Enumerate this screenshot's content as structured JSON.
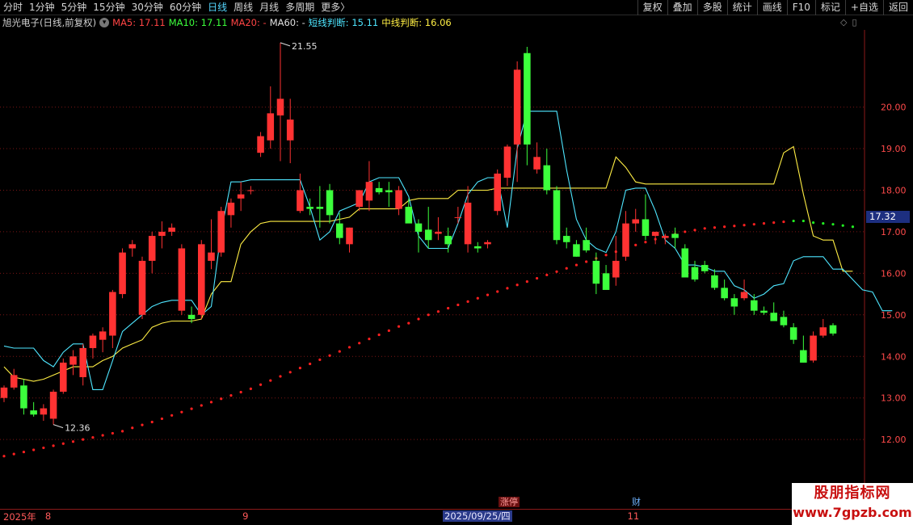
{
  "toolbar": {
    "tabs": [
      {
        "label": "分时"
      },
      {
        "label": "1分钟"
      },
      {
        "label": "5分钟"
      },
      {
        "label": "15分钟"
      },
      {
        "label": "30分钟"
      },
      {
        "label": "60分钟"
      },
      {
        "label": "日线"
      },
      {
        "label": "周线"
      },
      {
        "label": "月线"
      },
      {
        "label": "多周期"
      },
      {
        "label": "更多〉"
      }
    ],
    "active_tab": "日线",
    "right_buttons": [
      {
        "label": "复权"
      },
      {
        "label": "叠加"
      },
      {
        "label": "多股"
      },
      {
        "label": "统计"
      },
      {
        "label": "画线"
      },
      {
        "label": "F10"
      },
      {
        "label": "标记"
      },
      {
        "label": "+自选"
      },
      {
        "label": "返回"
      }
    ]
  },
  "info": {
    "stock": "旭光电子(日线,前复权)",
    "ma5": "MA5: 17.11",
    "ma10": "MA10: 17.11",
    "ma20": "MA20: -",
    "ma60": "MA60: -",
    "short_judge": "短线判断: 15.11",
    "mid_judge": "中线判断: 16.06"
  },
  "colors": {
    "up": "#ff3232",
    "down": "#3cff3c",
    "short_line": "#4ee6ff",
    "mid_line": "#ffee44",
    "red_dots": "#ff2020",
    "green_dots": "#22ee22",
    "grid": "#7a1515",
    "axis_text": "#ff4a4a"
  },
  "chart_data": {
    "type": "candlestick",
    "y_ticks": [
      "20.00",
      "19.00",
      "18.00",
      "17.00",
      "16.00",
      "15.00",
      "14.00",
      "13.00",
      "12.00"
    ],
    "y_tick_values": [
      20,
      19,
      18,
      17,
      16,
      15,
      14,
      13,
      12
    ],
    "ylim": [
      11.4,
      21.8
    ],
    "high_label": "21.55",
    "low_label": "12.36",
    "current_price_tag": "17.32",
    "candles_ohlc": [
      [
        13.0,
        13.3,
        12.9,
        13.25
      ],
      [
        13.25,
        13.7,
        13.2,
        13.55
      ],
      [
        13.3,
        13.45,
        12.6,
        12.75
      ],
      [
        12.7,
        12.9,
        12.55,
        12.6
      ],
      [
        12.6,
        12.85,
        12.45,
        12.75
      ],
      [
        12.5,
        13.2,
        12.36,
        13.15
      ],
      [
        13.15,
        13.95,
        13.1,
        13.85
      ],
      [
        13.8,
        14.15,
        13.55,
        14.0
      ],
      [
        13.5,
        14.3,
        13.3,
        14.2
      ],
      [
        14.2,
        14.55,
        13.95,
        14.5
      ],
      [
        14.4,
        14.7,
        14.1,
        14.6
      ],
      [
        14.5,
        15.6,
        14.2,
        15.55
      ],
      [
        15.5,
        16.6,
        15.4,
        16.5
      ],
      [
        16.6,
        16.8,
        16.4,
        16.7
      ],
      [
        15.0,
        16.4,
        14.9,
        16.3
      ],
      [
        16.3,
        17.0,
        16.0,
        16.9
      ],
      [
        16.9,
        17.25,
        16.6,
        17.0
      ],
      [
        17.0,
        17.2,
        16.9,
        17.1
      ],
      [
        15.1,
        16.7,
        15.0,
        16.6
      ],
      [
        15.0,
        15.2,
        14.8,
        14.9
      ],
      [
        15.0,
        16.8,
        14.9,
        16.7
      ],
      [
        16.3,
        17.3,
        16.1,
        16.5
      ],
      [
        16.5,
        17.6,
        16.4,
        17.5
      ],
      [
        17.4,
        17.8,
        17.1,
        17.7
      ],
      [
        17.8,
        18.2,
        17.5,
        17.9
      ],
      [
        18.0,
        18.1,
        17.9,
        18.0
      ],
      [
        18.9,
        19.4,
        18.8,
        19.3
      ],
      [
        19.2,
        20.5,
        19.0,
        19.85
      ],
      [
        19.8,
        21.55,
        18.7,
        20.2
      ],
      [
        19.2,
        20.2,
        18.65,
        19.7
      ],
      [
        17.5,
        18.4,
        17.45,
        18.0
      ],
      [
        17.6,
        17.8,
        17.4,
        17.55
      ],
      [
        17.6,
        18.1,
        17.1,
        17.55
      ],
      [
        18.0,
        18.15,
        17.2,
        17.4
      ],
      [
        17.2,
        17.45,
        16.7,
        16.85
      ],
      [
        16.7,
        17.1,
        16.5,
        17.1
      ],
      [
        17.6,
        18.0,
        17.5,
        18.0
      ],
      [
        17.75,
        18.7,
        17.5,
        18.2
      ],
      [
        18.05,
        18.2,
        17.9,
        17.95
      ],
      [
        18.0,
        18.2,
        17.6,
        17.95
      ],
      [
        17.55,
        18.1,
        17.4,
        18.0
      ],
      [
        17.6,
        17.8,
        17.4,
        17.2
      ],
      [
        17.2,
        17.3,
        16.5,
        17.0
      ],
      [
        17.05,
        17.6,
        16.6,
        16.8
      ],
      [
        16.95,
        17.35,
        16.8,
        17.0
      ],
      [
        16.9,
        17.1,
        16.5,
        16.7
      ],
      [
        17.35,
        17.6,
        17.2,
        17.35
      ],
      [
        16.7,
        18.1,
        16.5,
        17.7
      ],
      [
        16.65,
        16.75,
        16.5,
        16.6
      ],
      [
        16.7,
        16.8,
        16.6,
        16.75
      ],
      [
        17.5,
        18.5,
        17.4,
        18.4
      ],
      [
        18.3,
        19.1,
        18.1,
        19.05
      ],
      [
        19.1,
        21.1,
        18.2,
        20.9
      ],
      [
        21.3,
        21.45,
        18.6,
        19.1
      ],
      [
        18.5,
        19.15,
        18.4,
        18.8
      ],
      [
        18.6,
        19.0,
        17.9,
        18.0
      ],
      [
        18.0,
        18.1,
        16.7,
        16.8
      ],
      [
        16.9,
        17.1,
        16.6,
        16.75
      ],
      [
        16.7,
        16.8,
        16.4,
        16.4
      ],
      [
        16.8,
        17.1,
        16.5,
        16.55
      ],
      [
        16.3,
        16.5,
        15.5,
        15.75
      ],
      [
        16.0,
        16.2,
        15.8,
        15.6
      ],
      [
        15.9,
        16.9,
        15.7,
        16.3
      ],
      [
        16.4,
        17.5,
        16.3,
        17.2
      ],
      [
        17.2,
        17.55,
        17.0,
        17.3
      ],
      [
        17.3,
        17.9,
        16.8,
        16.9
      ],
      [
        16.9,
        17.0,
        16.7,
        17.0
      ],
      [
        16.85,
        16.95,
        16.7,
        16.9
      ],
      [
        16.95,
        17.1,
        16.6,
        16.85
      ],
      [
        16.6,
        16.7,
        16.0,
        15.9
      ],
      [
        16.15,
        16.3,
        15.8,
        15.85
      ],
      [
        16.2,
        16.3,
        16.0,
        16.05
      ],
      [
        15.95,
        16.1,
        15.6,
        15.65
      ],
      [
        15.65,
        15.85,
        15.35,
        15.4
      ],
      [
        15.4,
        15.5,
        15.0,
        15.2
      ],
      [
        15.4,
        15.85,
        15.35,
        15.55
      ],
      [
        15.35,
        15.5,
        15.0,
        15.1
      ],
      [
        15.1,
        15.2,
        15.0,
        15.05
      ],
      [
        15.05,
        15.3,
        14.9,
        14.85
      ],
      [
        14.95,
        15.1,
        14.7,
        14.75
      ],
      [
        14.7,
        14.8,
        14.3,
        14.4
      ],
      [
        14.15,
        14.5,
        13.85,
        13.85
      ],
      [
        13.9,
        14.6,
        13.85,
        14.5
      ],
      [
        14.5,
        14.9,
        14.45,
        14.7
      ],
      [
        14.75,
        14.8,
        14.5,
        14.55
      ]
    ],
    "short_judge_line": [
      14.25,
      14.2,
      14.2,
      14.2,
      13.9,
      13.75,
      14.1,
      14.3,
      14.3,
      13.2,
      13.2,
      13.9,
      14.6,
      14.8,
      15.0,
      15.2,
      15.3,
      15.35,
      15.35,
      15.35,
      15.0,
      15.2,
      17.0,
      18.2,
      18.2,
      18.25,
      18.25,
      18.25,
      18.25,
      18.25,
      18.25,
      17.6,
      16.8,
      17.0,
      17.5,
      17.6,
      17.7,
      18.2,
      18.3,
      18.3,
      18.3,
      17.85,
      16.9,
      16.6,
      16.6,
      16.6,
      17.2,
      17.9,
      18.2,
      18.3,
      18.3,
      17.1,
      19.0,
      19.9,
      19.9,
      19.9,
      19.9,
      18.5,
      17.3,
      16.8,
      16.6,
      16.5,
      17.0,
      18.0,
      18.05,
      18.05,
      17.5,
      16.8,
      16.6,
      16.2,
      16.2,
      16.15,
      16.05,
      16.05,
      15.7,
      15.6,
      15.4,
      15.5,
      15.7,
      15.75,
      16.3,
      16.4,
      16.4,
      16.4,
      16.1,
      16.1,
      15.85,
      15.6,
      15.55,
      15.1,
      15.1
    ],
    "mid_judge_line": [
      13.75,
      13.5,
      13.45,
      13.4,
      13.45,
      13.55,
      13.65,
      13.75,
      13.75,
      13.75,
      13.9,
      14.0,
      14.2,
      14.3,
      14.4,
      14.7,
      14.8,
      14.85,
      14.85,
      14.85,
      14.9,
      15.5,
      15.8,
      15.8,
      16.7,
      17.0,
      17.2,
      17.25,
      17.25,
      17.25,
      17.25,
      17.25,
      17.25,
      17.25,
      17.3,
      17.35,
      17.55,
      17.55,
      17.55,
      17.55,
      17.55,
      17.75,
      17.8,
      17.8,
      17.8,
      17.8,
      18.0,
      18.0,
      18.0,
      18.0,
      18.05,
      18.05,
      18.05,
      18.05,
      18.05,
      18.05,
      18.05,
      18.05,
      18.05,
      18.05,
      18.05,
      18.05,
      18.8,
      18.55,
      18.2,
      18.15,
      18.15,
      18.15,
      18.15,
      18.15,
      18.15,
      18.15,
      18.15,
      18.15,
      18.15,
      18.15,
      18.15,
      18.15,
      18.15,
      18.9,
      19.05,
      17.9,
      16.9,
      16.8,
      16.8,
      16.05,
      16.05
    ],
    "dot_line": [
      11.6,
      11.65,
      11.7,
      11.75,
      11.8,
      11.85,
      11.9,
      11.95,
      12.0,
      12.05,
      12.1,
      12.15,
      12.2,
      12.28,
      12.35,
      12.42,
      12.5,
      12.58,
      12.66,
      12.74,
      12.82,
      12.9,
      12.98,
      13.06,
      13.14,
      13.22,
      13.32,
      13.42,
      13.52,
      13.62,
      13.72,
      13.82,
      13.92,
      14.02,
      14.12,
      14.22,
      14.32,
      14.42,
      14.52,
      14.62,
      14.72,
      14.8,
      14.9,
      15.0,
      15.08,
      15.16,
      15.24,
      15.32,
      15.4,
      15.48,
      15.56,
      15.64,
      15.72,
      15.8,
      15.88,
      15.96,
      16.04,
      16.12,
      16.2,
      16.28,
      16.36,
      16.44,
      16.52,
      16.6,
      16.68,
      16.75,
      16.82,
      16.88,
      16.94,
      17.0,
      17.04,
      17.08,
      17.1,
      17.12,
      17.14,
      17.16,
      17.18,
      17.2,
      17.22,
      17.24,
      17.26,
      17.26,
      17.22,
      17.2,
      17.18,
      17.15,
      17.12
    ],
    "dot_green_from_index": 80,
    "date_labels": [
      {
        "text": "2025年",
        "index": 0
      },
      {
        "text": "8",
        "index": 4
      },
      {
        "text": "9",
        "index": 24
      },
      {
        "text": "11",
        "index": 63
      }
    ],
    "cursor_date": "2025/09/25/四"
  },
  "markers": {
    "zt": "涨停",
    "cai": "财"
  },
  "price_tag": "17.32",
  "watermark": {
    "line1": "股朋指标网",
    "line2": "www.7gpzb.com"
  }
}
